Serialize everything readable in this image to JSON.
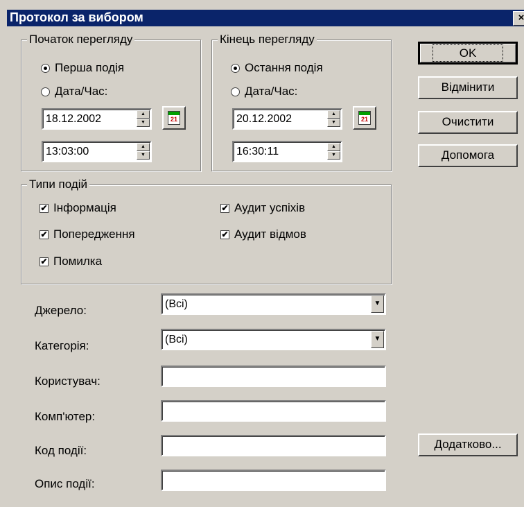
{
  "title": "Протокол за вибором",
  "close_glyph": "×",
  "start_group": {
    "legend": "Початок перегляду",
    "first_event_label": "Перша подія",
    "date_time_label": "Дата/Час:",
    "date": "18.12.2002",
    "time": "13:03:00",
    "selected": "first_event"
  },
  "end_group": {
    "legend": "Кінець перегляду",
    "last_event_label": "Остання подія",
    "date_time_label": "Дата/Час:",
    "date": "20.12.2002",
    "time": "16:30:11",
    "selected": "last_event"
  },
  "calendar_day": "21",
  "event_types": {
    "legend": "Типи подій",
    "information": "Інформація",
    "warning": "Попередження",
    "error": "Помилка",
    "audit_success": "Аудит успіхів",
    "audit_failure": "Аудит відмов",
    "checked_mark": "✔"
  },
  "filters": {
    "source_label": "Джерело:",
    "source_value": "(Всі)",
    "category_label": "Категорія:",
    "category_value": "(Всі)",
    "user_label": "Користувач:",
    "user_value": "",
    "computer_label": "Комп'ютер:",
    "computer_value": "",
    "event_id_label": "Код події:",
    "event_id_value": "",
    "description_label": "Опис події:",
    "description_value": ""
  },
  "buttons": {
    "ok": "OK",
    "cancel": "Відмінити",
    "clear": "Очистити",
    "help": "Допомога",
    "advanced": "Додатково..."
  }
}
